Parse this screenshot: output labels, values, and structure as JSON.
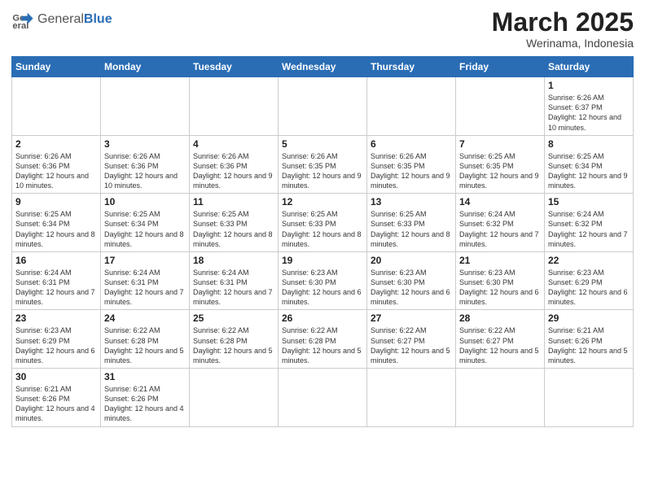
{
  "logo": {
    "text_general": "General",
    "text_blue": "Blue"
  },
  "title": {
    "main": "March 2025",
    "sub": "Werinama, Indonesia"
  },
  "weekdays": [
    "Sunday",
    "Monday",
    "Tuesday",
    "Wednesday",
    "Thursday",
    "Friday",
    "Saturday"
  ],
  "weeks": [
    [
      {
        "day": "",
        "info": ""
      },
      {
        "day": "",
        "info": ""
      },
      {
        "day": "",
        "info": ""
      },
      {
        "day": "",
        "info": ""
      },
      {
        "day": "",
        "info": ""
      },
      {
        "day": "",
        "info": ""
      },
      {
        "day": "1",
        "info": "Sunrise: 6:26 AM\nSunset: 6:37 PM\nDaylight: 12 hours and 10 minutes."
      }
    ],
    [
      {
        "day": "2",
        "info": "Sunrise: 6:26 AM\nSunset: 6:36 PM\nDaylight: 12 hours and 10 minutes."
      },
      {
        "day": "3",
        "info": "Sunrise: 6:26 AM\nSunset: 6:36 PM\nDaylight: 12 hours and 10 minutes."
      },
      {
        "day": "4",
        "info": "Sunrise: 6:26 AM\nSunset: 6:36 PM\nDaylight: 12 hours and 9 minutes."
      },
      {
        "day": "5",
        "info": "Sunrise: 6:26 AM\nSunset: 6:35 PM\nDaylight: 12 hours and 9 minutes."
      },
      {
        "day": "6",
        "info": "Sunrise: 6:26 AM\nSunset: 6:35 PM\nDaylight: 12 hours and 9 minutes."
      },
      {
        "day": "7",
        "info": "Sunrise: 6:25 AM\nSunset: 6:35 PM\nDaylight: 12 hours and 9 minutes."
      },
      {
        "day": "8",
        "info": "Sunrise: 6:25 AM\nSunset: 6:34 PM\nDaylight: 12 hours and 9 minutes."
      }
    ],
    [
      {
        "day": "9",
        "info": "Sunrise: 6:25 AM\nSunset: 6:34 PM\nDaylight: 12 hours and 8 minutes."
      },
      {
        "day": "10",
        "info": "Sunrise: 6:25 AM\nSunset: 6:34 PM\nDaylight: 12 hours and 8 minutes."
      },
      {
        "day": "11",
        "info": "Sunrise: 6:25 AM\nSunset: 6:33 PM\nDaylight: 12 hours and 8 minutes."
      },
      {
        "day": "12",
        "info": "Sunrise: 6:25 AM\nSunset: 6:33 PM\nDaylight: 12 hours and 8 minutes."
      },
      {
        "day": "13",
        "info": "Sunrise: 6:25 AM\nSunset: 6:33 PM\nDaylight: 12 hours and 8 minutes."
      },
      {
        "day": "14",
        "info": "Sunrise: 6:24 AM\nSunset: 6:32 PM\nDaylight: 12 hours and 7 minutes."
      },
      {
        "day": "15",
        "info": "Sunrise: 6:24 AM\nSunset: 6:32 PM\nDaylight: 12 hours and 7 minutes."
      }
    ],
    [
      {
        "day": "16",
        "info": "Sunrise: 6:24 AM\nSunset: 6:31 PM\nDaylight: 12 hours and 7 minutes."
      },
      {
        "day": "17",
        "info": "Sunrise: 6:24 AM\nSunset: 6:31 PM\nDaylight: 12 hours and 7 minutes."
      },
      {
        "day": "18",
        "info": "Sunrise: 6:24 AM\nSunset: 6:31 PM\nDaylight: 12 hours and 7 minutes."
      },
      {
        "day": "19",
        "info": "Sunrise: 6:23 AM\nSunset: 6:30 PM\nDaylight: 12 hours and 6 minutes."
      },
      {
        "day": "20",
        "info": "Sunrise: 6:23 AM\nSunset: 6:30 PM\nDaylight: 12 hours and 6 minutes."
      },
      {
        "day": "21",
        "info": "Sunrise: 6:23 AM\nSunset: 6:30 PM\nDaylight: 12 hours and 6 minutes."
      },
      {
        "day": "22",
        "info": "Sunrise: 6:23 AM\nSunset: 6:29 PM\nDaylight: 12 hours and 6 minutes."
      }
    ],
    [
      {
        "day": "23",
        "info": "Sunrise: 6:23 AM\nSunset: 6:29 PM\nDaylight: 12 hours and 6 minutes."
      },
      {
        "day": "24",
        "info": "Sunrise: 6:22 AM\nSunset: 6:28 PM\nDaylight: 12 hours and 5 minutes."
      },
      {
        "day": "25",
        "info": "Sunrise: 6:22 AM\nSunset: 6:28 PM\nDaylight: 12 hours and 5 minutes."
      },
      {
        "day": "26",
        "info": "Sunrise: 6:22 AM\nSunset: 6:28 PM\nDaylight: 12 hours and 5 minutes."
      },
      {
        "day": "27",
        "info": "Sunrise: 6:22 AM\nSunset: 6:27 PM\nDaylight: 12 hours and 5 minutes."
      },
      {
        "day": "28",
        "info": "Sunrise: 6:22 AM\nSunset: 6:27 PM\nDaylight: 12 hours and 5 minutes."
      },
      {
        "day": "29",
        "info": "Sunrise: 6:21 AM\nSunset: 6:26 PM\nDaylight: 12 hours and 5 minutes."
      }
    ],
    [
      {
        "day": "30",
        "info": "Sunrise: 6:21 AM\nSunset: 6:26 PM\nDaylight: 12 hours and 4 minutes."
      },
      {
        "day": "31",
        "info": "Sunrise: 6:21 AM\nSunset: 6:26 PM\nDaylight: 12 hours and 4 minutes."
      },
      {
        "day": "",
        "info": ""
      },
      {
        "day": "",
        "info": ""
      },
      {
        "day": "",
        "info": ""
      },
      {
        "day": "",
        "info": ""
      },
      {
        "day": "",
        "info": ""
      }
    ]
  ]
}
